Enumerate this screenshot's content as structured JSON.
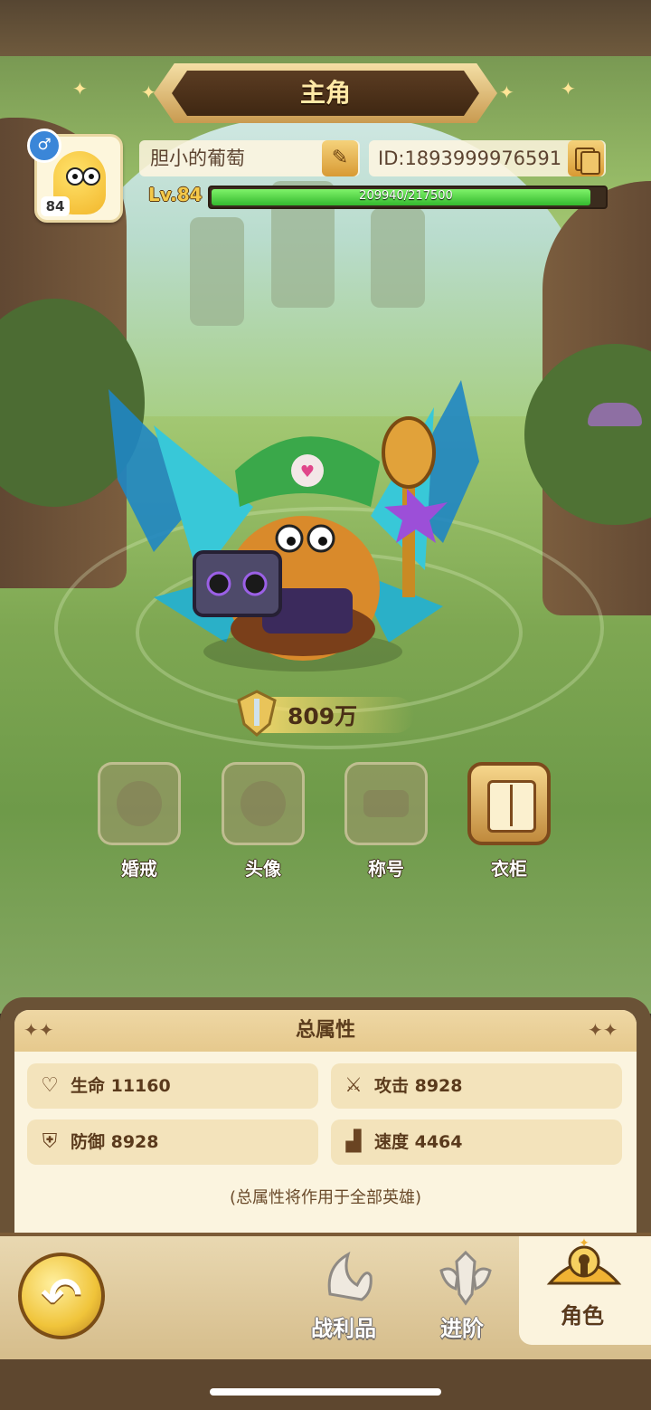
{
  "header": {
    "title": "主角"
  },
  "profile": {
    "avatar_level": "84",
    "gender_symbol": "♂",
    "name": "胆小的葡萄",
    "id_text": "ID:1893999976591",
    "level_text": "Lv.84",
    "xp_text": "209940/217500",
    "xp_fraction": 0.965
  },
  "power": {
    "value": "809万"
  },
  "features": [
    {
      "label": "婚戒",
      "active": false
    },
    {
      "label": "头像",
      "active": false
    },
    {
      "label": "称号",
      "active": false
    },
    {
      "label": "衣柜",
      "active": true
    }
  ],
  "attributes": {
    "title": "总属性",
    "stats": [
      {
        "icon": "heart-icon",
        "text": "生命 11160"
      },
      {
        "icon": "claw-icon",
        "text": "攻击 8928"
      },
      {
        "icon": "shield-icon",
        "text": "防御 8928"
      },
      {
        "icon": "boot-icon",
        "text": "速度 4464"
      }
    ],
    "note": "(总属性将作用于全部英雄)"
  },
  "nav": {
    "items": [
      {
        "label": "战利品",
        "icon": "loot-icon"
      },
      {
        "label": "进阶",
        "icon": "advance-icon"
      },
      {
        "label": "角色",
        "icon": "character-icon",
        "selected": true
      }
    ]
  },
  "colors": {
    "xp_fill": "#34b92e",
    "accent_gold": "#f0c43a",
    "panel_bg": "#fbf4df"
  }
}
